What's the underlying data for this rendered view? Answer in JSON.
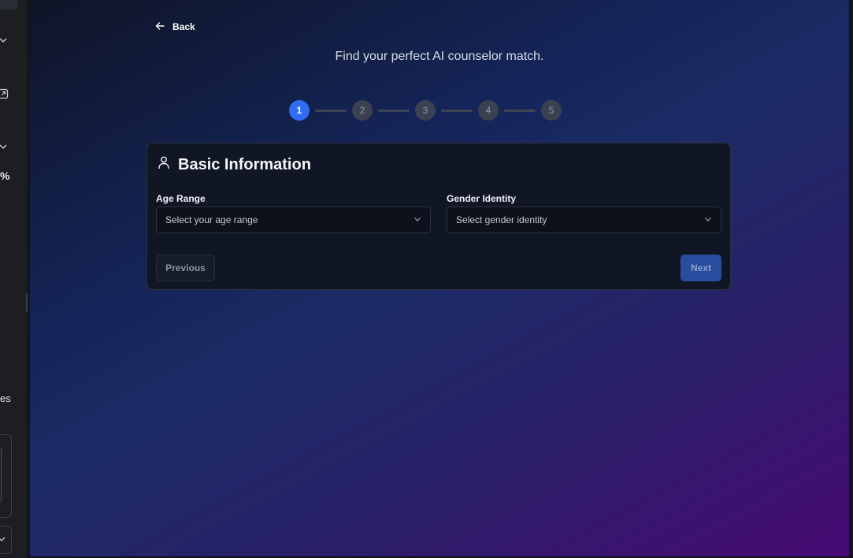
{
  "left_panel": {
    "percent_text": "%",
    "es_text": "es"
  },
  "nav": {
    "back_label": "Back"
  },
  "header": {
    "subtitle": "Find your perfect AI counselor match."
  },
  "stepper": {
    "steps": [
      "1",
      "2",
      "3",
      "4",
      "5"
    ],
    "active_step": 1
  },
  "card": {
    "title": "Basic Information",
    "age_range": {
      "label": "Age Range",
      "placeholder": "Select your age range"
    },
    "gender_identity": {
      "label": "Gender Identity",
      "placeholder": "Select gender identity"
    },
    "previous_label": "Previous",
    "next_label": "Next"
  },
  "colors": {
    "accent": "#2f6cf2",
    "next_button": "#284d9e",
    "card_bg": "#111624"
  }
}
